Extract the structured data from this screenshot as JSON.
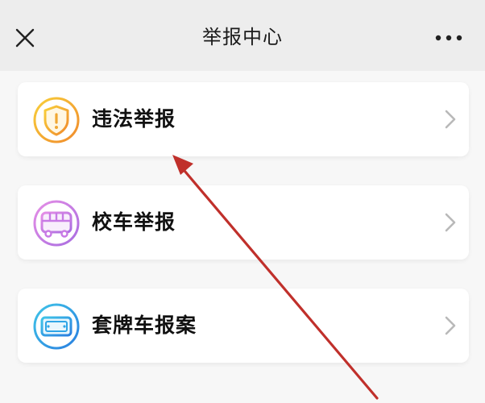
{
  "header": {
    "title": "举报中心",
    "close_icon": "close-icon",
    "more_icon": "more-dots-icon"
  },
  "menu": {
    "items": [
      {
        "label": "违法举报",
        "icon": "shield-alert-icon",
        "accent": "#f0a733"
      },
      {
        "label": "校车举报",
        "icon": "bus-icon",
        "accent": "#c87ae5"
      },
      {
        "label": "套牌车报案",
        "icon": "license-plate-icon",
        "accent": "#2fa5e6"
      }
    ]
  },
  "annotation": {
    "arrow_color": "#c0302b",
    "icon": "annotation-arrow-icon"
  }
}
